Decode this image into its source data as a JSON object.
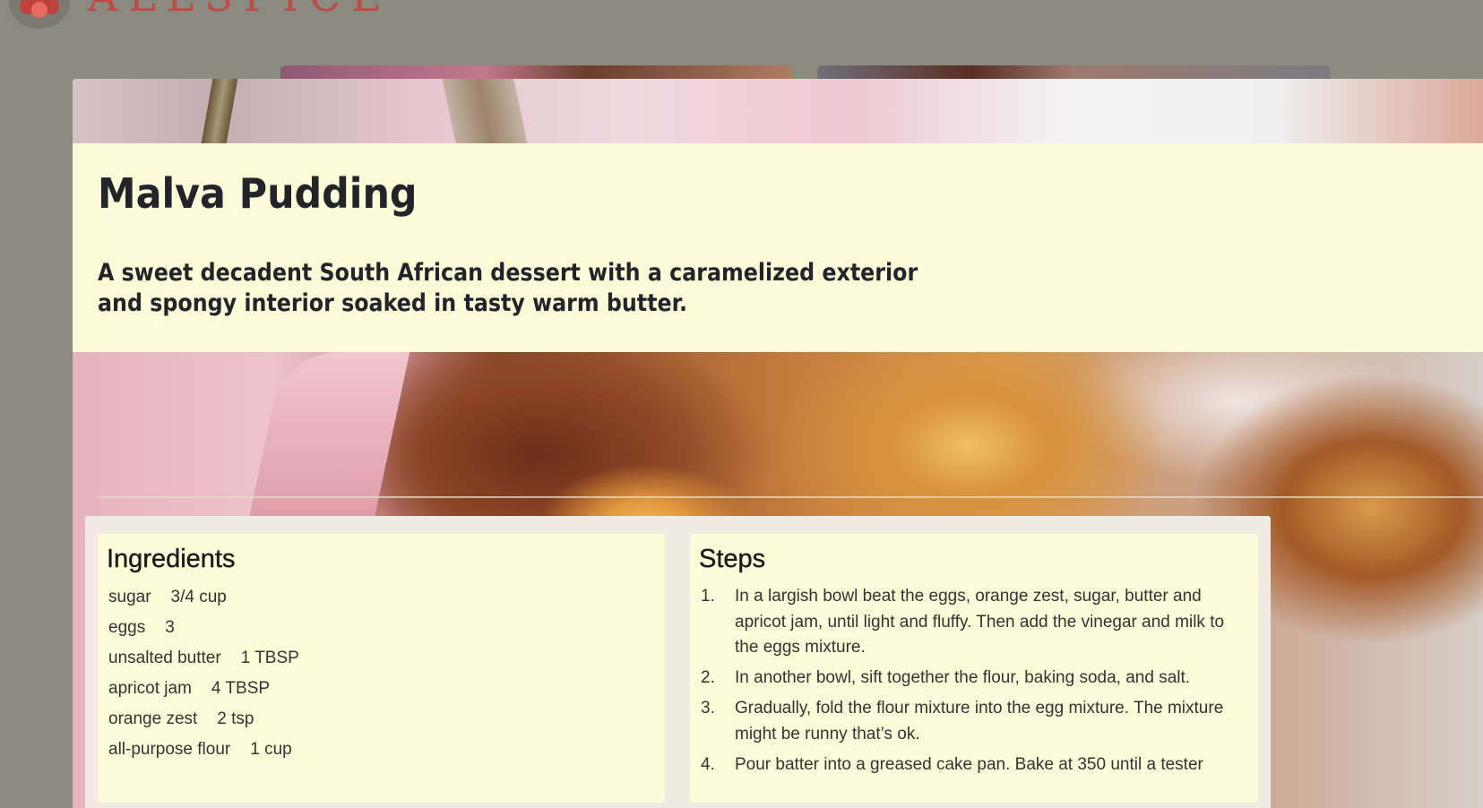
{
  "header": {
    "brand": "ALLSPICE",
    "logo_icon": "flower-logo-icon",
    "colors": {
      "brand": "#c24a44",
      "backdrop": "#8a8a7e"
    }
  },
  "modal": {
    "title": "Malva Pudding",
    "description": "A sweet decadent South African dessert with a caramelized exterior and spongy interior soaked in tasty warm butter.",
    "colors": {
      "panel": "#fefcd8",
      "text": "#212529"
    },
    "ingredients": {
      "heading": "Ingredients",
      "items": [
        {
          "name": "sugar",
          "quantity": "3/4 cup"
        },
        {
          "name": "eggs",
          "quantity": "3"
        },
        {
          "name": "unsalted butter",
          "quantity": "1 TBSP"
        },
        {
          "name": "apricot jam",
          "quantity": "4 TBSP"
        },
        {
          "name": "orange zest",
          "quantity": "2 tsp"
        },
        {
          "name": "all-purpose flour",
          "quantity": "1 cup"
        }
      ]
    },
    "steps": {
      "heading": "Steps",
      "items": [
        {
          "number": "1.",
          "text": "In a largish bowl beat the eggs, orange zest, sugar, butter and apricot jam, until light and fluffy. Then add the vinegar and milk to the eggs mixture."
        },
        {
          "number": "2.",
          "text": "In another bowl, sift together the flour, baking soda, and salt."
        },
        {
          "number": "3.",
          "text": "Gradually, fold the flour mixture into the egg mixture. The mixture might be runny that’s ok."
        },
        {
          "number": "4.",
          "text": "Pour batter into a greased cake pan. Bake at 350 until a tester"
        }
      ]
    }
  }
}
